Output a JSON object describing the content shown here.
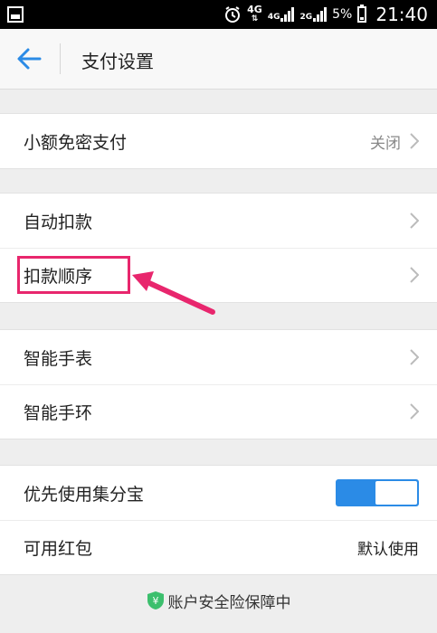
{
  "status_bar": {
    "net1": "4G",
    "net1_sub": "⇅",
    "net2": "4G",
    "net3": "2G",
    "battery": "5%",
    "time": "21:40",
    "icons": [
      "image-icon",
      "alarm-icon",
      "signal-icon",
      "battery-icon"
    ]
  },
  "header": {
    "title": "支付设置"
  },
  "sections": {
    "small_pay": {
      "label": "小额免密支付",
      "value": "关闭"
    },
    "auto_deduct": {
      "label": "自动扣款"
    },
    "deduct_order": {
      "label": "扣款顺序"
    },
    "smart_watch": {
      "label": "智能手表"
    },
    "smart_band": {
      "label": "智能手环"
    },
    "jifenbao": {
      "label": "优先使用集分宝",
      "toggle_on": true
    },
    "red_packet": {
      "label": "可用红包",
      "value": "默认使用"
    }
  },
  "footer": {
    "text": "账户安全险保障中",
    "icon_glyph": "¥"
  },
  "colors": {
    "accent": "#2b8be6",
    "annotation": "#e8266d",
    "shield": "#3cbf6d"
  }
}
